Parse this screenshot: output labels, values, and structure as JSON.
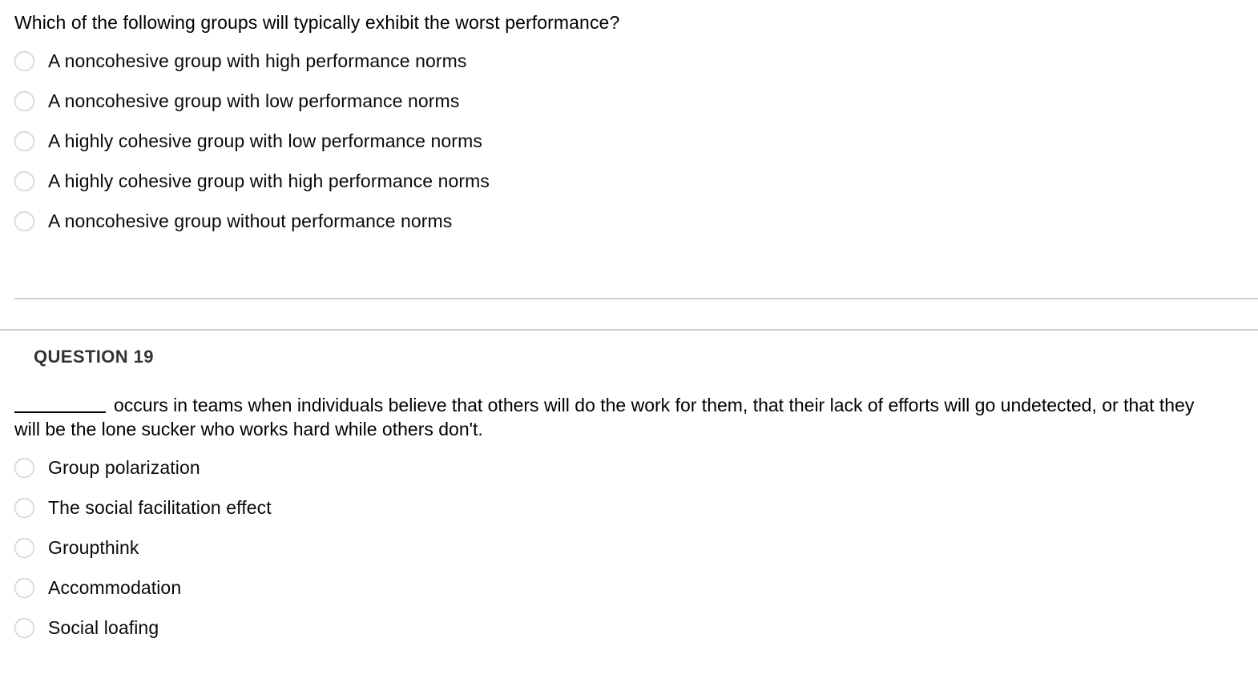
{
  "page": {
    "background_color": "#ffffff",
    "text_color": "#000000",
    "divider_color": "#cfcfcf",
    "header_color": "#333333"
  },
  "question_18": {
    "stem": "Which of the following groups will typically exhibit the worst performance?",
    "options": [
      {
        "label": "A noncohesive group with high performance norms",
        "selected": false
      },
      {
        "label": "A noncohesive group with low performance norms",
        "selected": false
      },
      {
        "label": "A highly cohesive group with low performance norms",
        "selected": false
      },
      {
        "label": "A highly cohesive group with high performance norms",
        "selected": false
      },
      {
        "label": "A noncohesive group without performance norms",
        "selected": false
      }
    ]
  },
  "question_19": {
    "header": "QUESTION 19",
    "blank_text": "_________",
    "stem_after_blank": "occurs in teams when individuals believe that others will do the work for them, that their lack of efforts will go undetected, or that they will be the lone sucker who works hard while others don't.",
    "options": [
      {
        "label": "Group polarization",
        "selected": false
      },
      {
        "label": "The social facilitation effect",
        "selected": false
      },
      {
        "label": "Groupthink",
        "selected": false
      },
      {
        "label": "Accommodation",
        "selected": false
      },
      {
        "label": "Social loafing",
        "selected": false
      }
    ]
  }
}
